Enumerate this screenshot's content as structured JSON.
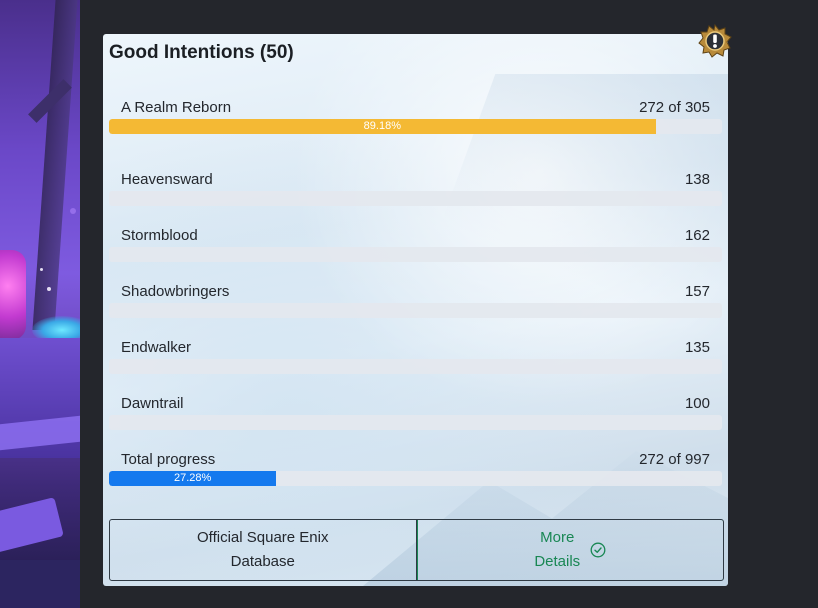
{
  "card": {
    "title": "Good Intentions (50)",
    "alert_icon": "alert-exclamation-icon"
  },
  "rows": [
    {
      "label": "A Realm Reborn",
      "value": "272 of 305",
      "percent": 89.18,
      "percent_label": "89.18%",
      "color": "#f4b934"
    },
    {
      "label": "Heavensward",
      "value": "138",
      "percent": 0,
      "percent_label": ""
    },
    {
      "label": "Stormblood",
      "value": "162",
      "percent": 0,
      "percent_label": ""
    },
    {
      "label": "Shadowbringers",
      "value": "157",
      "percent": 0,
      "percent_label": ""
    },
    {
      "label": "Endwalker",
      "value": "135",
      "percent": 0,
      "percent_label": ""
    },
    {
      "label": "Dawntrail",
      "value": "100",
      "percent": 0,
      "percent_label": ""
    },
    {
      "label": "Total progress",
      "value": "272 of 997",
      "percent": 27.28,
      "percent_label": "27.28%",
      "color": "#1479ee"
    }
  ],
  "buttons": {
    "database_label": "Official Square Enix\nDatabase",
    "details_label": "More\nDetails",
    "details_icon": "check-circle-icon",
    "details_color": "#198754"
  }
}
